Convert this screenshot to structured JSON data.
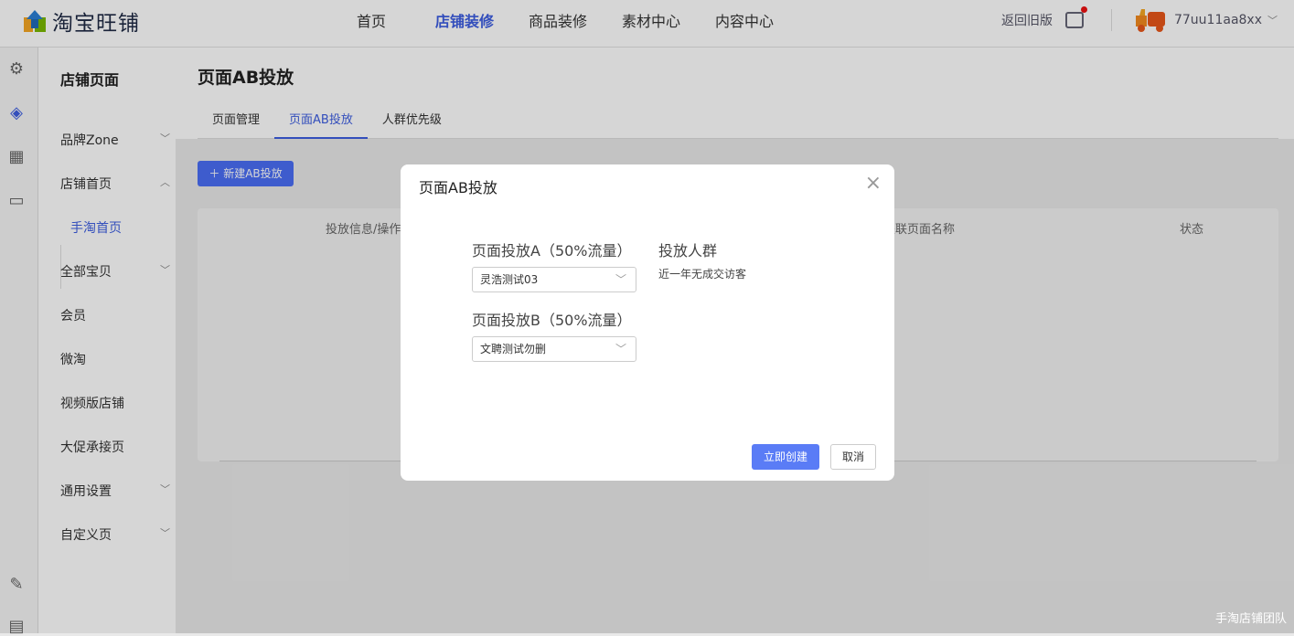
{
  "header": {
    "logo_text": "淘宝旺铺",
    "nav": [
      {
        "label": "首页"
      },
      {
        "label": "店铺装修",
        "active": true
      },
      {
        "label": "商品装修"
      },
      {
        "label": "素材中心"
      },
      {
        "label": "内容中心"
      }
    ],
    "old_version": "返回旧版",
    "username": "77uu11aa8xx",
    "accent": "#3d5ee0"
  },
  "sidebar": {
    "title": "店铺页面",
    "items": [
      {
        "label": "品牌Zone",
        "chevron": "down"
      },
      {
        "label": "店铺首页",
        "chevron": "up"
      },
      {
        "label": "手淘首页",
        "active": true
      },
      {
        "label": "全部宝贝",
        "chevron": "down"
      },
      {
        "label": "会员"
      },
      {
        "label": "微淘"
      },
      {
        "label": "视频版店铺"
      },
      {
        "label": "大促承接页"
      },
      {
        "label": "通用设置",
        "chevron": "down"
      },
      {
        "label": "自定义页",
        "chevron": "down"
      }
    ]
  },
  "main": {
    "title": "页面AB投放",
    "tabs": [
      {
        "label": "页面管理"
      },
      {
        "label": "页面AB投放",
        "active": true
      },
      {
        "label": "人群优先级"
      }
    ],
    "new_button": "新建AB投放",
    "columns": [
      "投放信息/操作",
      "关联页面名称",
      "状态"
    ]
  },
  "modal": {
    "title": "页面AB投放",
    "label_a": "页面投放A（50%流量）",
    "select_a": "灵浩测试03",
    "label_b": "页面投放B（50%流量）",
    "select_b": "文聘测试勿删",
    "audience_label": "投放人群",
    "audience_value": "近一年无成交访客",
    "confirm": "立即创建",
    "cancel": "取消"
  },
  "watermark": "手淘店铺团队"
}
